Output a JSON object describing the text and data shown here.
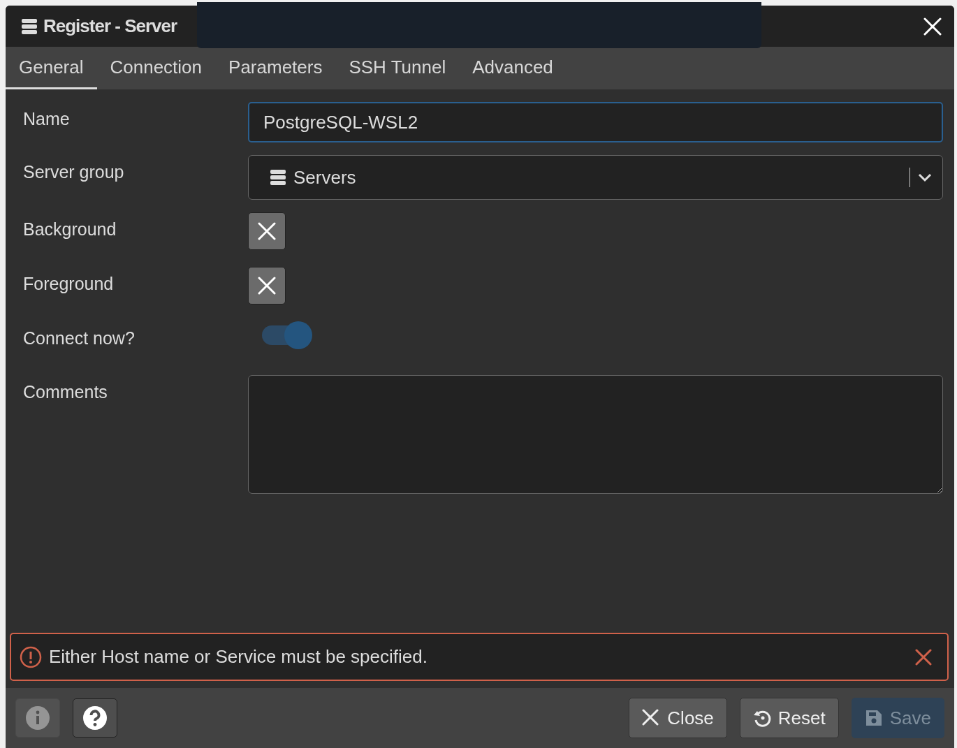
{
  "window": {
    "title": "Register - Server"
  },
  "tabs": [
    {
      "label": "General",
      "selected": true
    },
    {
      "label": "Connection",
      "selected": false
    },
    {
      "label": "Parameters",
      "selected": false
    },
    {
      "label": "SSH Tunnel",
      "selected": false
    },
    {
      "label": "Advanced",
      "selected": false
    }
  ],
  "fields": [
    {
      "kind": "text",
      "label": "Name",
      "value": "PostgreSQL-WSL2"
    },
    {
      "kind": "select",
      "label": "Server group",
      "value": "Servers"
    },
    {
      "kind": "color",
      "label": "Background"
    },
    {
      "kind": "color",
      "label": "Foreground"
    },
    {
      "kind": "switch",
      "label": "Connect now?",
      "on": true
    },
    {
      "kind": "textarea",
      "label": "Comments"
    }
  ],
  "error": {
    "message": "Either Host name or Service must be specified."
  },
  "footer": {
    "left": [
      {
        "kind": "info",
        "disabled": true
      },
      {
        "kind": "help",
        "disabled": false
      }
    ],
    "right": [
      {
        "kind": "close",
        "label": "Close",
        "disabled": false
      },
      {
        "kind": "reset",
        "label": "Reset",
        "disabled": false
      },
      {
        "kind": "save",
        "label": "Save",
        "disabled": true
      }
    ]
  }
}
